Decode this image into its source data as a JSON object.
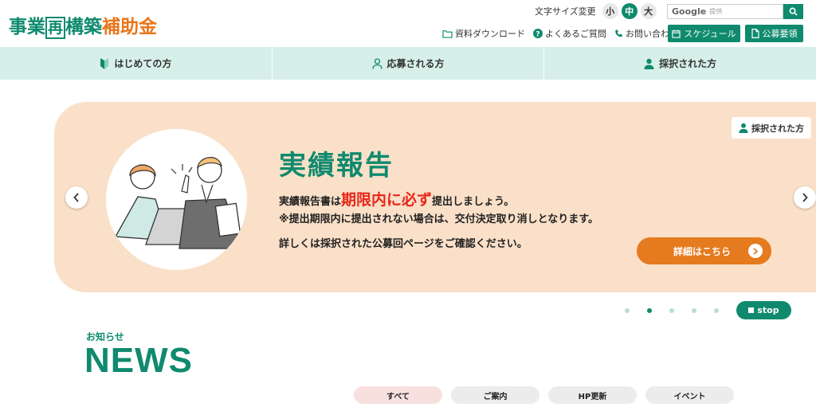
{
  "header": {
    "logo": {
      "part1": "事業",
      "boxed": "再",
      "part2": "構築",
      "accent": "補助金"
    },
    "font_size": {
      "label": "文字サイズ変更",
      "small": "小",
      "medium": "中",
      "large": "大"
    },
    "search": {
      "brand": "Google",
      "suffix": "提供"
    },
    "links": {
      "download": "資料ダウンロード",
      "faq": "よくあるご質問",
      "contact": "お問い合わせ"
    },
    "schedule_label": "スケジュール",
    "guidelines_label": "公募要領"
  },
  "nav": {
    "items": [
      {
        "label": "はじめての方"
      },
      {
        "label": "応募される方"
      },
      {
        "label": "採択された方"
      }
    ]
  },
  "hero": {
    "tag": "採択された方",
    "title": "実績報告",
    "line1_pre": "実績報告書は",
    "line1_emphasis": "期限内に必ず",
    "line1_post": "提出しましょう。",
    "line2": "※提出期限内に提出されない場合は、交付決定取り消しとなります。",
    "line3": "詳しくは採択された公募回ページをご確認ください。",
    "cta": "詳細はこちら",
    "stop": "stop",
    "slides_count": 5,
    "active_slide": 2
  },
  "news": {
    "subtitle": "お知らせ",
    "title": "NEWS",
    "tabs": [
      {
        "label": "すべて"
      },
      {
        "label": "ご案内"
      },
      {
        "label": "HP更新"
      },
      {
        "label": "イベント"
      }
    ]
  },
  "colors": {
    "brand_green": "#0f8a6e",
    "accent_orange": "#e57a1e",
    "hero_bg": "#fae0c8",
    "nav_bg": "#d7efe9",
    "emphasis_red": "#e8261b"
  }
}
